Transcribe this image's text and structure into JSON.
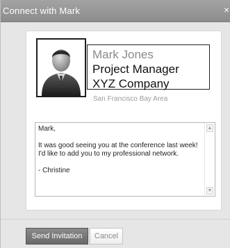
{
  "dialog": {
    "title": "Connect with Mark",
    "close_symbol": "×"
  },
  "profile": {
    "avatar_icon": "person-avatar-icon",
    "name": "Mark Jones",
    "title": "Project Manager",
    "company": "XYZ Company",
    "location": "San Francisco Bay Area"
  },
  "message": {
    "text": "Mark,\n\nIt was good seeing you at the conference last week! I'd like to add you to my professional network.\n\n- Christine"
  },
  "buttons": {
    "send_label": "Send Invitation",
    "cancel_label": "Cancel"
  },
  "icons": {
    "close": "close-icon",
    "scroll_up": "chevron-up-icon",
    "scroll_down": "chevron-down-icon"
  }
}
